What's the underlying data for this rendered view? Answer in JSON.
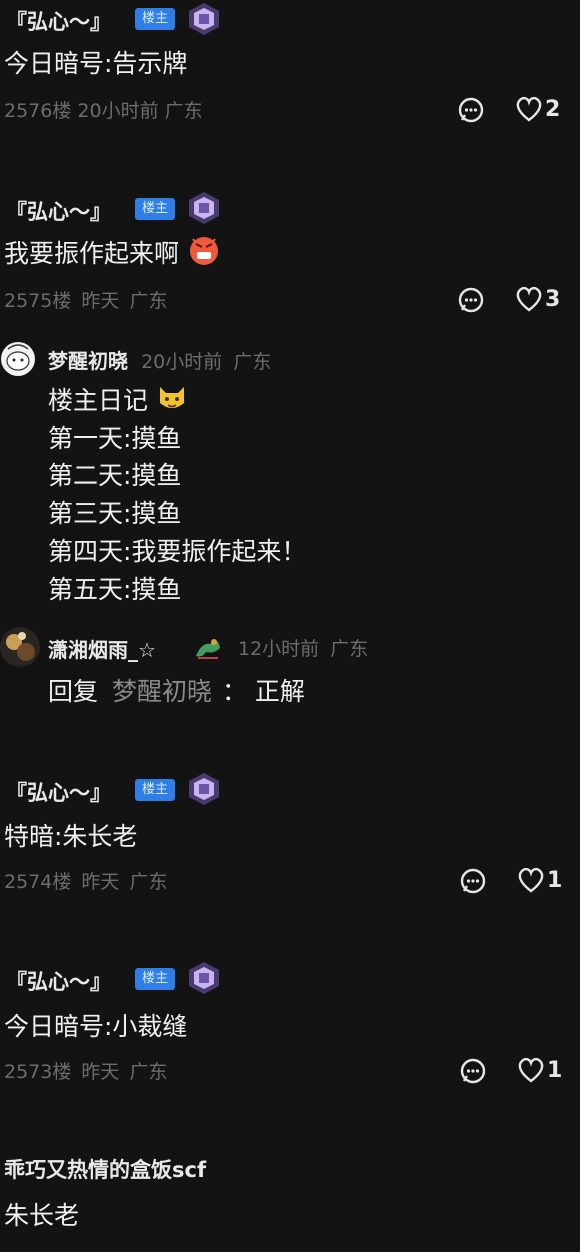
{
  "comments": [
    {
      "user": "『弘心～』",
      "badge": "楼主",
      "text": "今日暗号:告示牌",
      "floor": "2576楼",
      "time": "20小时前",
      "loc": "广东",
      "likes": "2"
    },
    {
      "user": "『弘心～』",
      "badge": "楼主",
      "text": "我要振作起来啊",
      "floor": "2575楼",
      "time": "昨天",
      "loc": "广东",
      "likes": "3"
    },
    {
      "user": "『弘心～』",
      "badge": "楼主",
      "text": "特暗:朱长老",
      "floor": "2574楼",
      "time": "昨天",
      "loc": "广东",
      "likes": "1"
    },
    {
      "user": "『弘心～』",
      "badge": "楼主",
      "text": "今日暗号:小裁缝",
      "floor": "2573楼",
      "time": "昨天",
      "loc": "广东",
      "likes": "1"
    },
    {
      "user": "乖巧又热情的盒饭scf",
      "text": "朱长老"
    }
  ],
  "replies": [
    {
      "user": "梦醒初晓",
      "time": "20小时前",
      "loc": "广东",
      "lines": [
        "楼主日记",
        "第一天:摸鱼",
        "第二天:摸鱼",
        "第三天:摸鱼",
        "第四天:我要振作起来！",
        "第五天:摸鱼"
      ]
    },
    {
      "user": "潇湘烟雨_☆",
      "time": "12小时前",
      "loc": "广东",
      "reply_prefix": "回复",
      "reply_to": "梦醒初晓",
      "reply_sep": "：",
      "reply_text": "正解"
    }
  ],
  "icons": {
    "comment": "comment-icon",
    "like": "heart-icon",
    "level": "level-gem-icon"
  },
  "colors": {
    "background": "#131313",
    "badge": "#2e7ee6",
    "meta": "#6c6c6c"
  }
}
